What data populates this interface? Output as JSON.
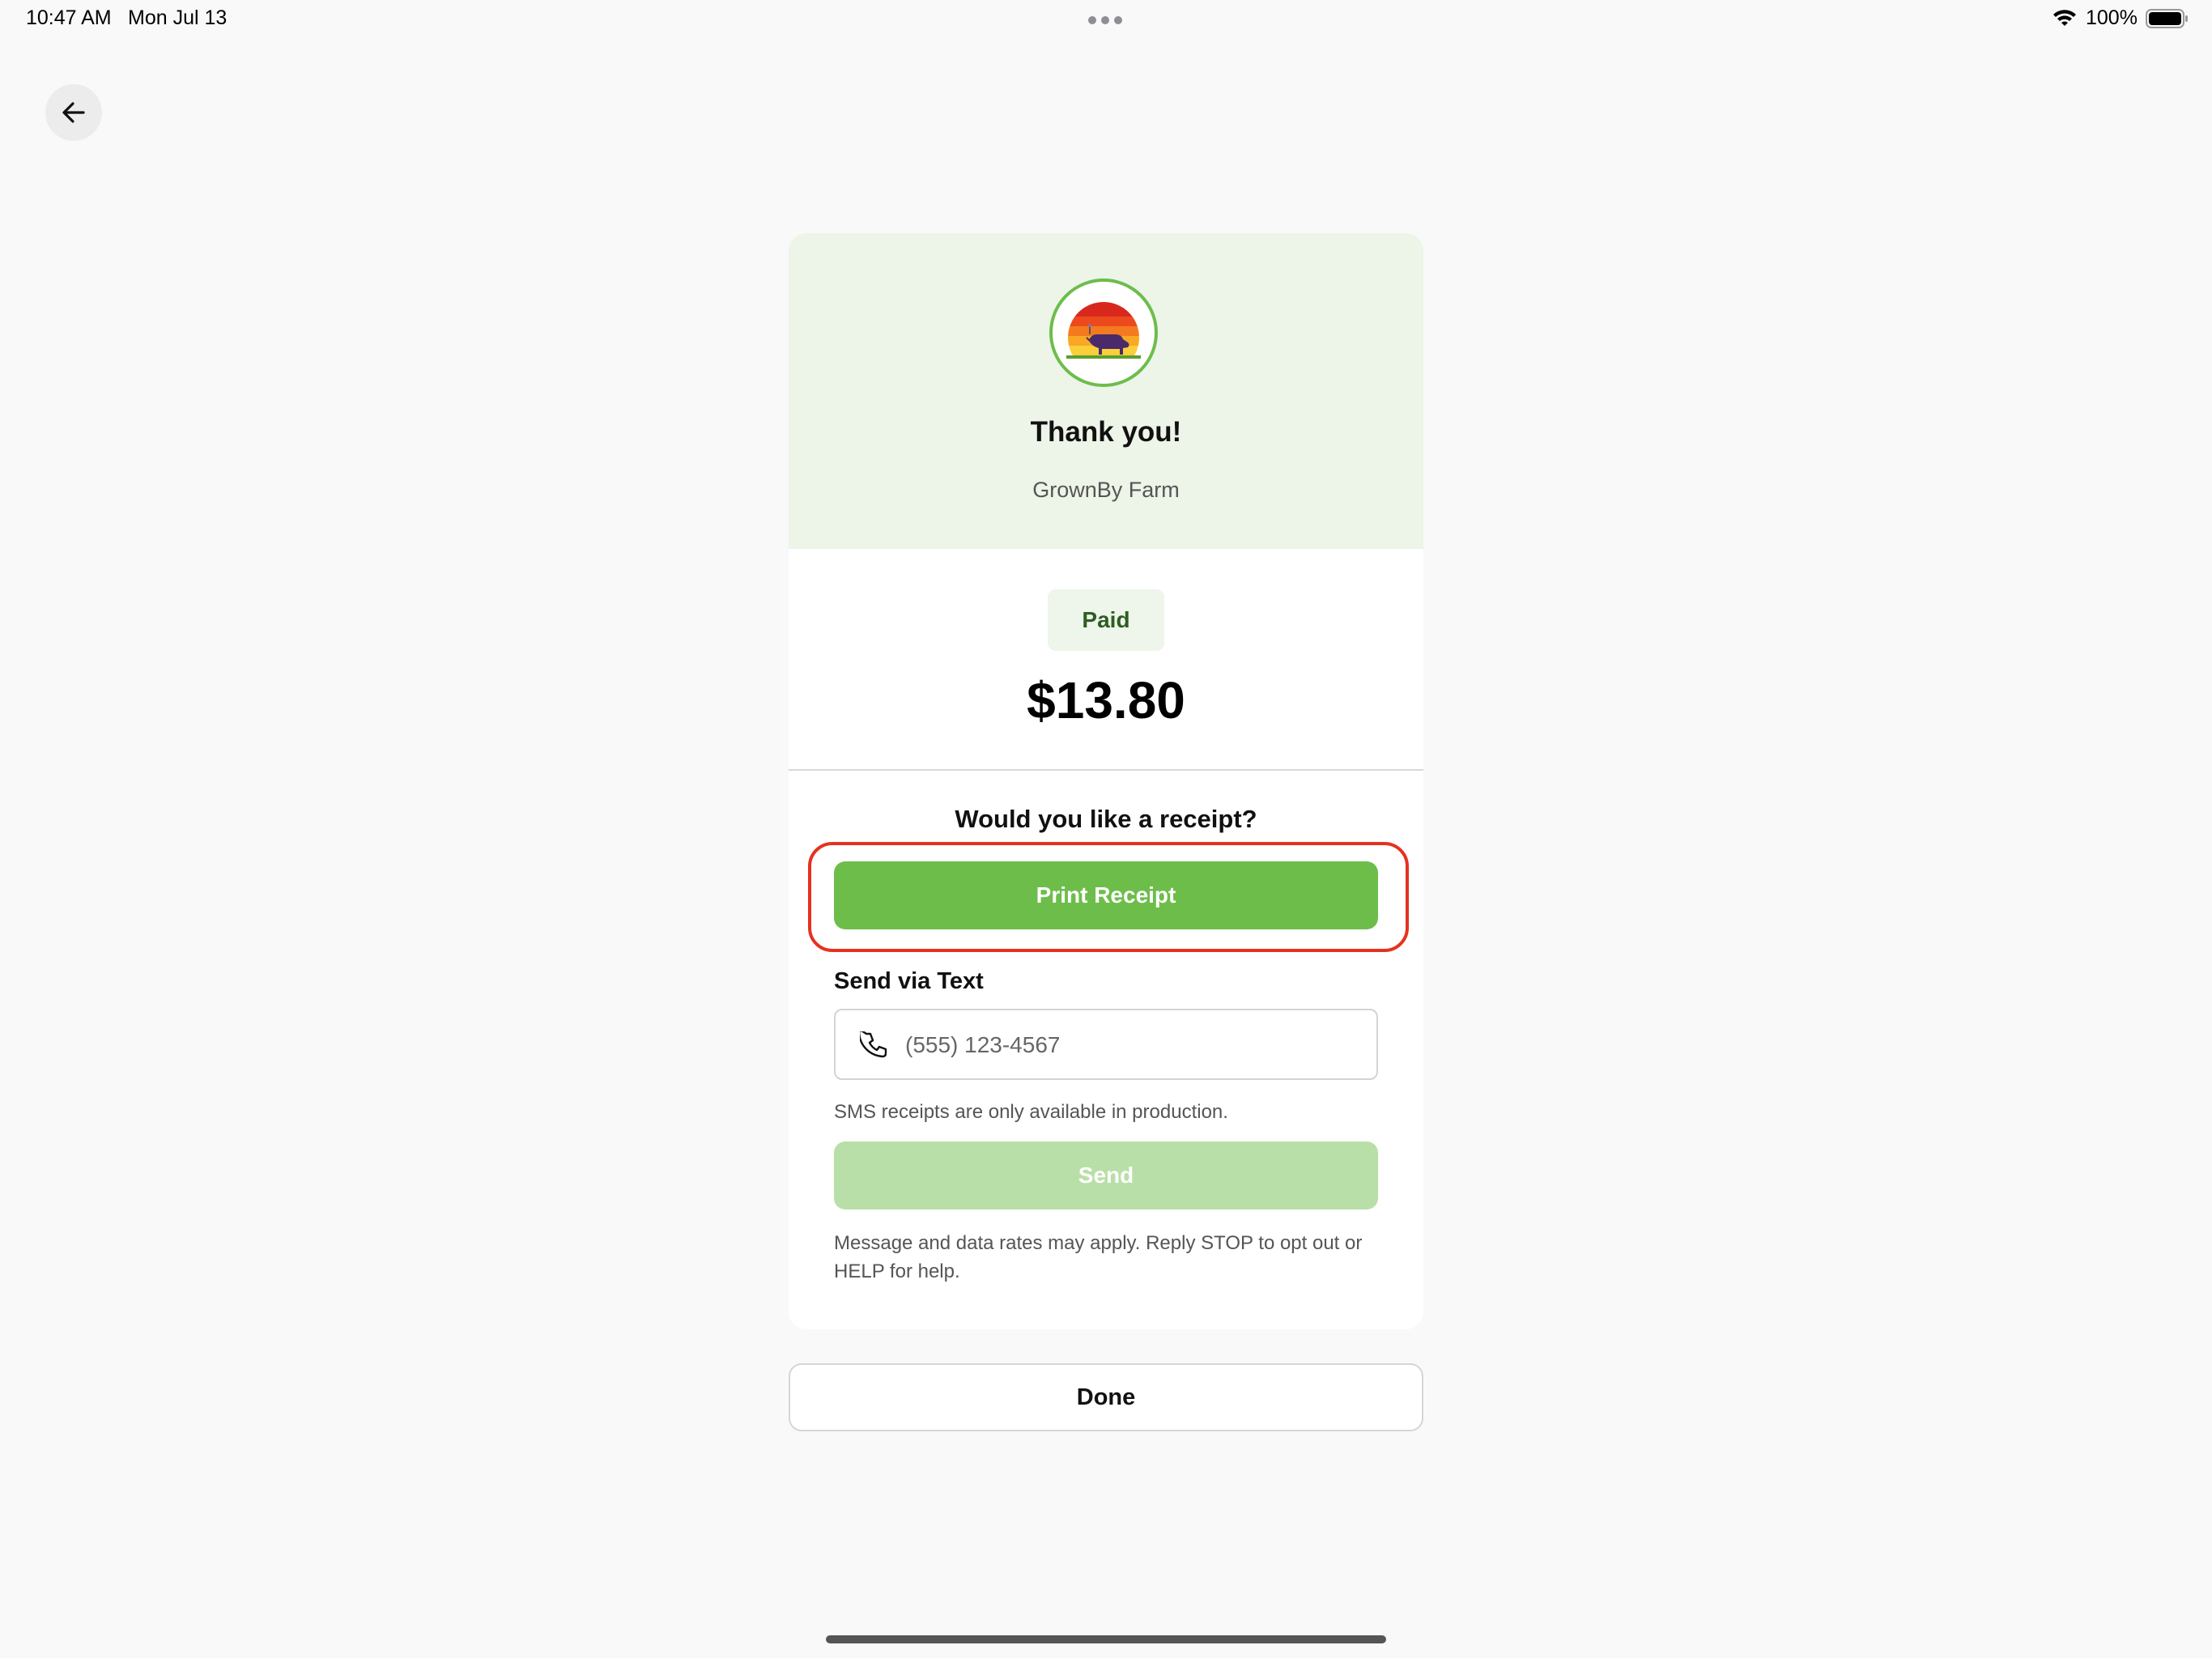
{
  "status_bar": {
    "time": "10:47 AM",
    "date": "Mon Jul 13",
    "battery": "100%"
  },
  "header": {
    "back_icon": "arrow-left-icon"
  },
  "card": {
    "logo_icon": "farm-cow-sunset-logo",
    "thank_you": "Thank you!",
    "farm_name": "GrownBy Farm",
    "status_badge": "Paid",
    "amount": "$13.80"
  },
  "receipt": {
    "question": "Would you like a receipt?",
    "print_label": "Print Receipt",
    "send_via_text_label": "Send via Text",
    "phone_placeholder": "(555) 123-4567",
    "phone_value": "",
    "sms_note": "SMS receipts are only available in production.",
    "send_label": "Send",
    "rates_note": "Message and data rates may apply. Reply STOP to opt out or HELP for help."
  },
  "footer": {
    "done_label": "Done"
  },
  "colors": {
    "accent_green": "#6dbd4b",
    "disabled_green": "#b8dfa7",
    "header_bg": "#edf4e8",
    "highlight_red": "#e5321f"
  }
}
